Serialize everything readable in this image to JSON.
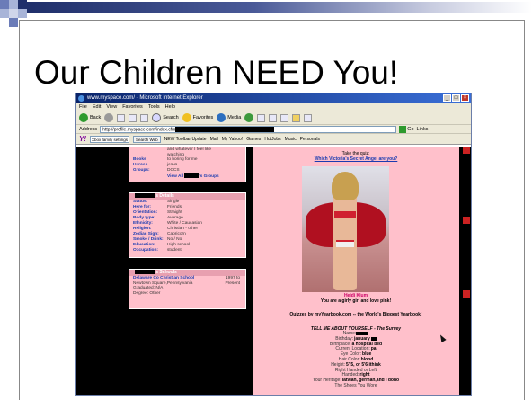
{
  "slide": {
    "title": "Our Children NEED You!",
    "accent_colors": [
      "#1f2f6a",
      "#6b7cb8",
      "#a8b4d8"
    ]
  },
  "browser": {
    "window_title": "www.myspace.com/ - Microsoft Internet Explorer",
    "window_controls": [
      "_",
      "□",
      "×"
    ],
    "menu": [
      "File",
      "Edit",
      "View",
      "Favorites",
      "Tools",
      "Help"
    ],
    "toolbar": {
      "back": "Back",
      "search": "Search",
      "favorites": "Favorites",
      "media": "Media"
    },
    "address": {
      "label": "Address",
      "url": "http://profile.myspace.com/index.cfm",
      "go": "Go",
      "links": "Links"
    },
    "yahoo_toolbar": {
      "logo": "Y!",
      "search_value": "Xbox family settings",
      "search_button": "Search Web",
      "items": [
        "NEW Toolbar Update",
        "Mail",
        "My Yahoo!",
        "Games",
        "HotJobs",
        "Music",
        "Personals"
      ]
    }
  },
  "profile": {
    "interests": {
      "pre_lines": [
        "and whatever I feel like",
        "watching"
      ],
      "rows": [
        {
          "k": "Books",
          "v": "to boring for me"
        },
        {
          "k": "Heroes",
          "v": "jesus"
        },
        {
          "k": "Groups:",
          "v": "DCCS"
        }
      ],
      "view_all": "View All",
      "groups_suffix": "'s Groups"
    },
    "details": {
      "header_suffix": "'s Details",
      "rows": [
        {
          "k": "Status:",
          "v": "Single"
        },
        {
          "k": "Here for:",
          "v": "Friends"
        },
        {
          "k": "Orientation:",
          "v": "Straight"
        },
        {
          "k": "Body type:",
          "v": "Average"
        },
        {
          "k": "Ethnicity:",
          "v": "White / Caucasian"
        },
        {
          "k": "Religion:",
          "v": "Christian - other"
        },
        {
          "k": "Zodiac Sign:",
          "v": "Capricorn"
        },
        {
          "k": "Smoke / Drink:",
          "v": "No / No"
        },
        {
          "k": "Education:",
          "v": "High school"
        },
        {
          "k": "Occupation:",
          "v": "student"
        }
      ]
    },
    "schools": {
      "header_suffix": "'s Schools",
      "name": "Delaware Co Christian School",
      "years": "1997 to",
      "years_end": "Present",
      "location": "Newtown Square,Pennsylvania",
      "graduated": "Graduated: N/A",
      "degree": "Degree: Other"
    },
    "quiz": {
      "take": "Take the quiz:",
      "link": "Which Victoria's Secret Angel are you?",
      "angel_name": "Heidi Klum",
      "result": "You are a girly girl and love pink!",
      "quizzes_line": "Quizzes by myYearbook.com -- the World's Biggest Yearbook!"
    },
    "survey": {
      "title": "TELL ME ABOUT YOURSELF - The Survey",
      "lines": [
        {
          "q": "Name:",
          "a": ""
        },
        {
          "q": "Birthday:",
          "a": "january"
        },
        {
          "q": "Birthplace:",
          "a": "a hospital bed"
        },
        {
          "q": "Current Location:",
          "a": "pa"
        },
        {
          "q": "Eye Color:",
          "a": "blue"
        },
        {
          "q": "Hair Color:",
          "a": "blond"
        },
        {
          "q": "Height:",
          "a": "5' 5, or 5'6 ithink"
        },
        {
          "q": "Right Handed or Left",
          "a": ""
        },
        {
          "q": "Handed:",
          "a": "right"
        },
        {
          "q": "Your Heritage:",
          "a": "latvian, german,and i dono"
        },
        {
          "q": "The Shoes You Wore",
          "a": ""
        }
      ]
    }
  }
}
